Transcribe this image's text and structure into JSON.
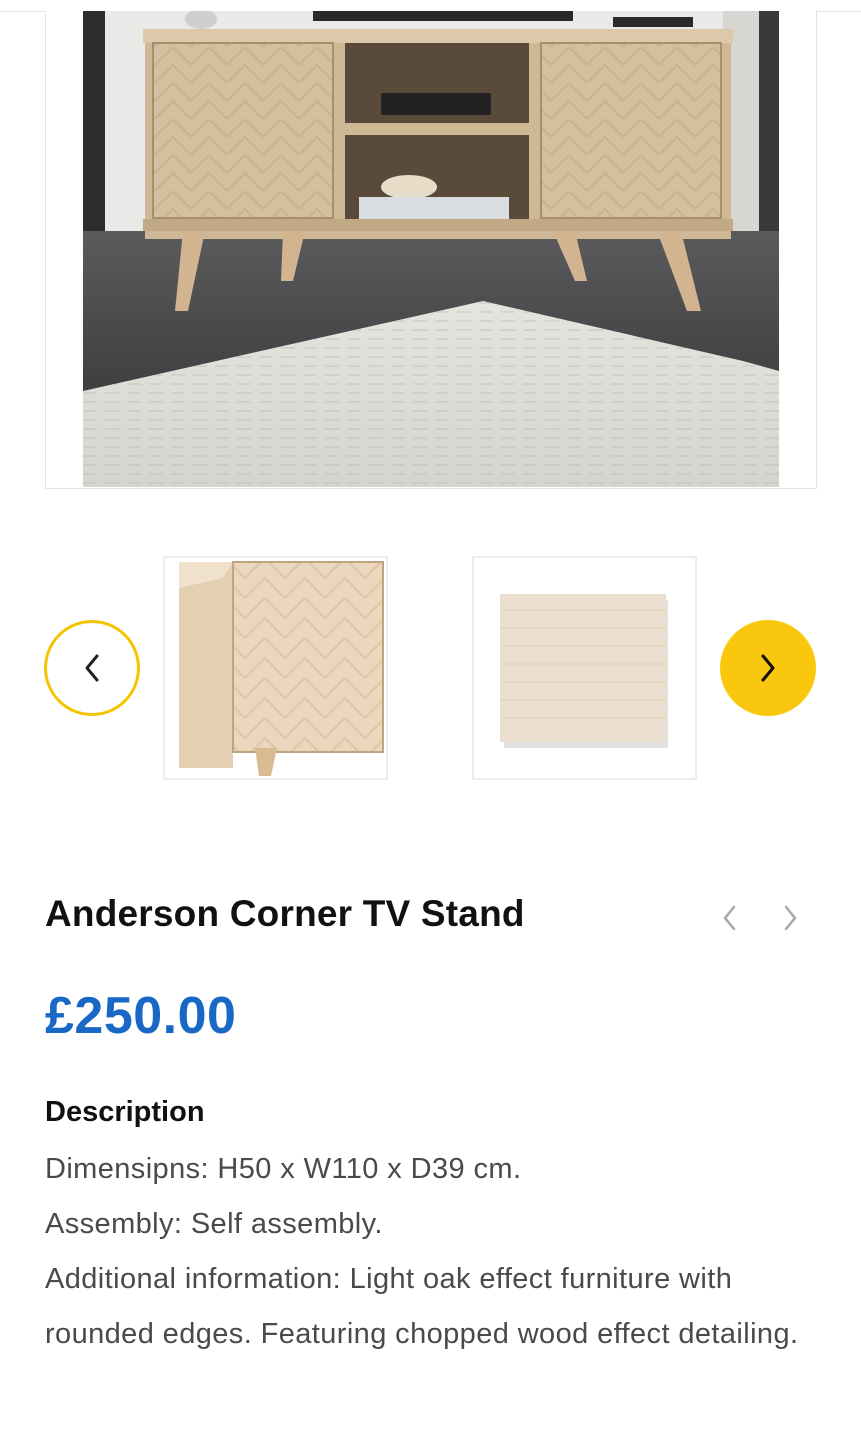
{
  "gallery": {
    "main_image_alt": "TV stand in room",
    "prev_icon": "chevron-left-icon",
    "next_icon": "chevron-right-icon",
    "accent_color": "#f9c80e",
    "thumbnails": [
      {
        "alt": "Cabinet door close-up"
      },
      {
        "alt": "Wood finish swatch"
      }
    ]
  },
  "product": {
    "title": "Anderson Corner TV Stand",
    "price": "£250.00",
    "price_color": "#1a68c5",
    "pager_prev_icon": "chevron-left-icon",
    "pager_next_icon": "chevron-right-icon"
  },
  "description": {
    "heading": "Description",
    "lines": [
      "Dimensipns: H50 x W110 x D39 cm.",
      "Assembly: Self assembly.",
      "Additional information: Light oak effect furniture with rounded edges. Featuring chopped wood effect detailing."
    ]
  }
}
